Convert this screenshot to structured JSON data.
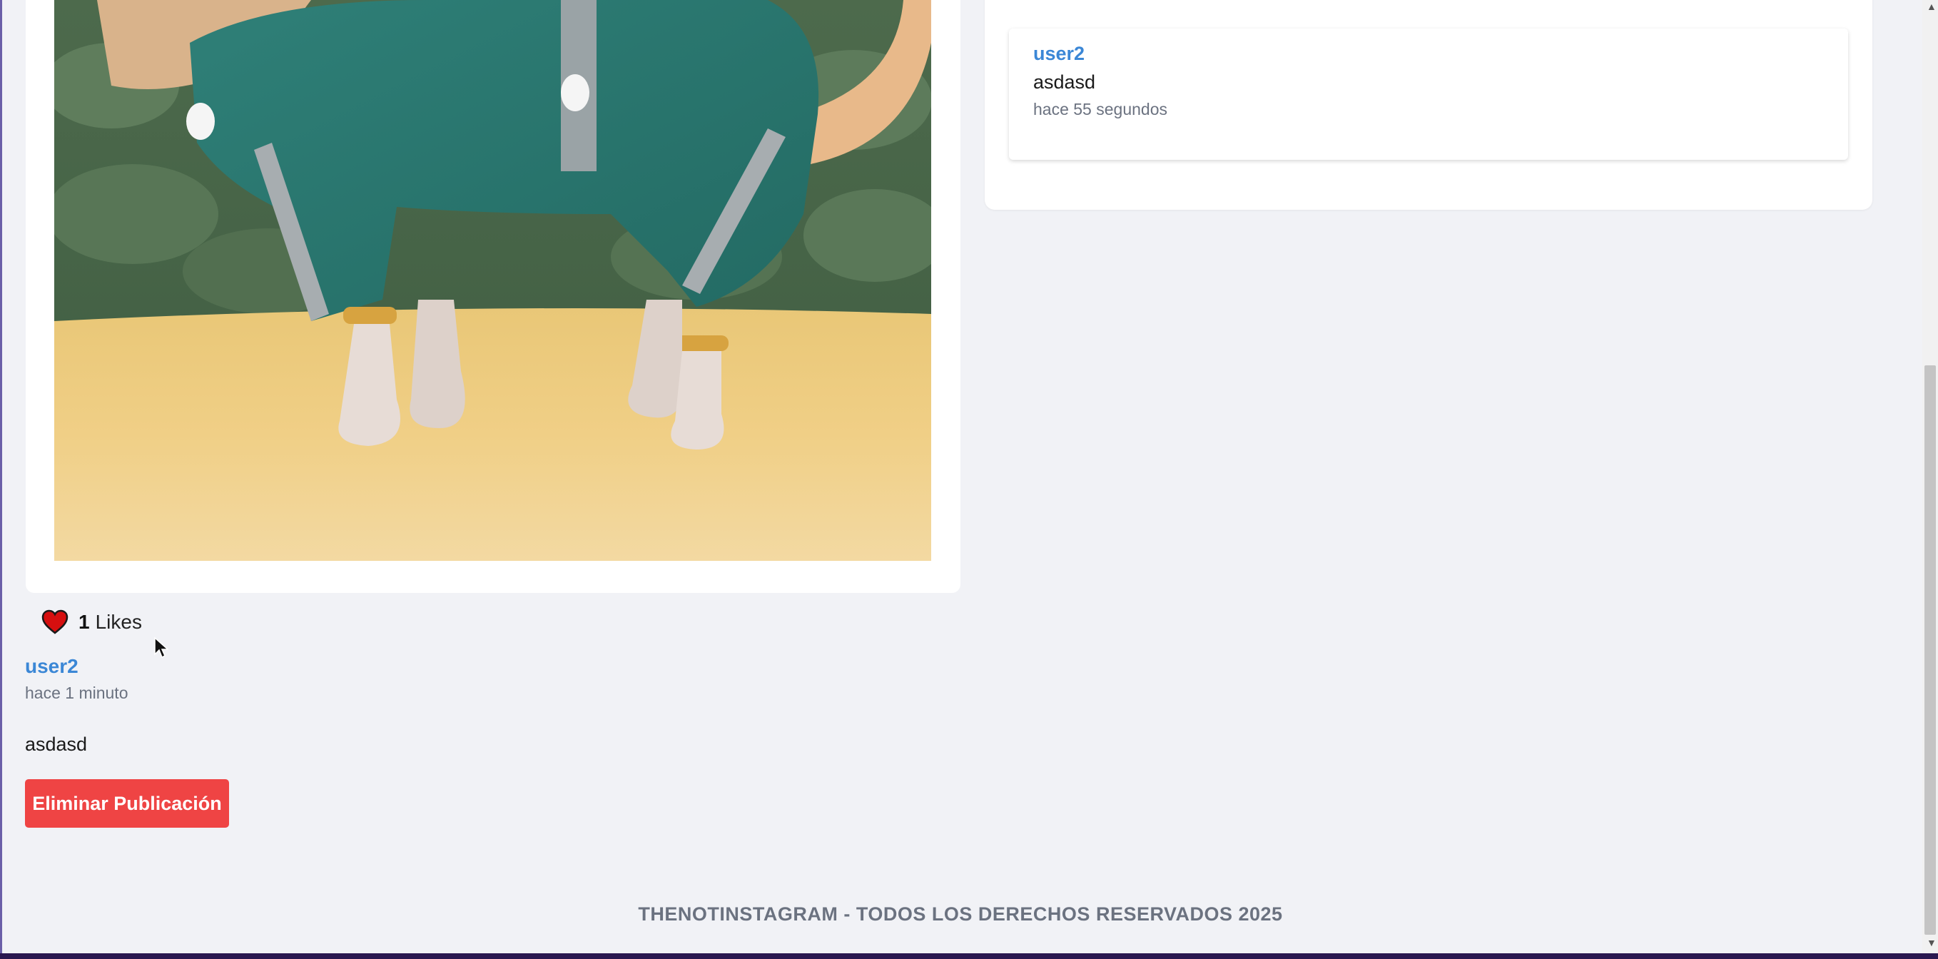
{
  "post": {
    "image_alt": "Chihuahua wearing a green raincoat",
    "likes_count": "1",
    "likes_label": "Likes",
    "author": "user2",
    "time_ago": "hace 1 minuto",
    "caption": "asdasd",
    "delete_button": "Eliminar Publicación"
  },
  "comments": [
    {
      "user": "user2",
      "text": "asdasd",
      "time_ago": "hace 55 segundos"
    }
  ],
  "footer": {
    "text": "THENOTINSTAGRAM - TODOS LOS DERECHOS RESERVADOS 2025"
  },
  "colors": {
    "background": "#f1f2f6",
    "link": "#3b87d6",
    "danger": "#ef4444",
    "muted": "#6b7280",
    "heart": "#d60f0f"
  },
  "icons": {
    "like": "heart-icon",
    "cursor": "mouse-pointer-icon"
  }
}
